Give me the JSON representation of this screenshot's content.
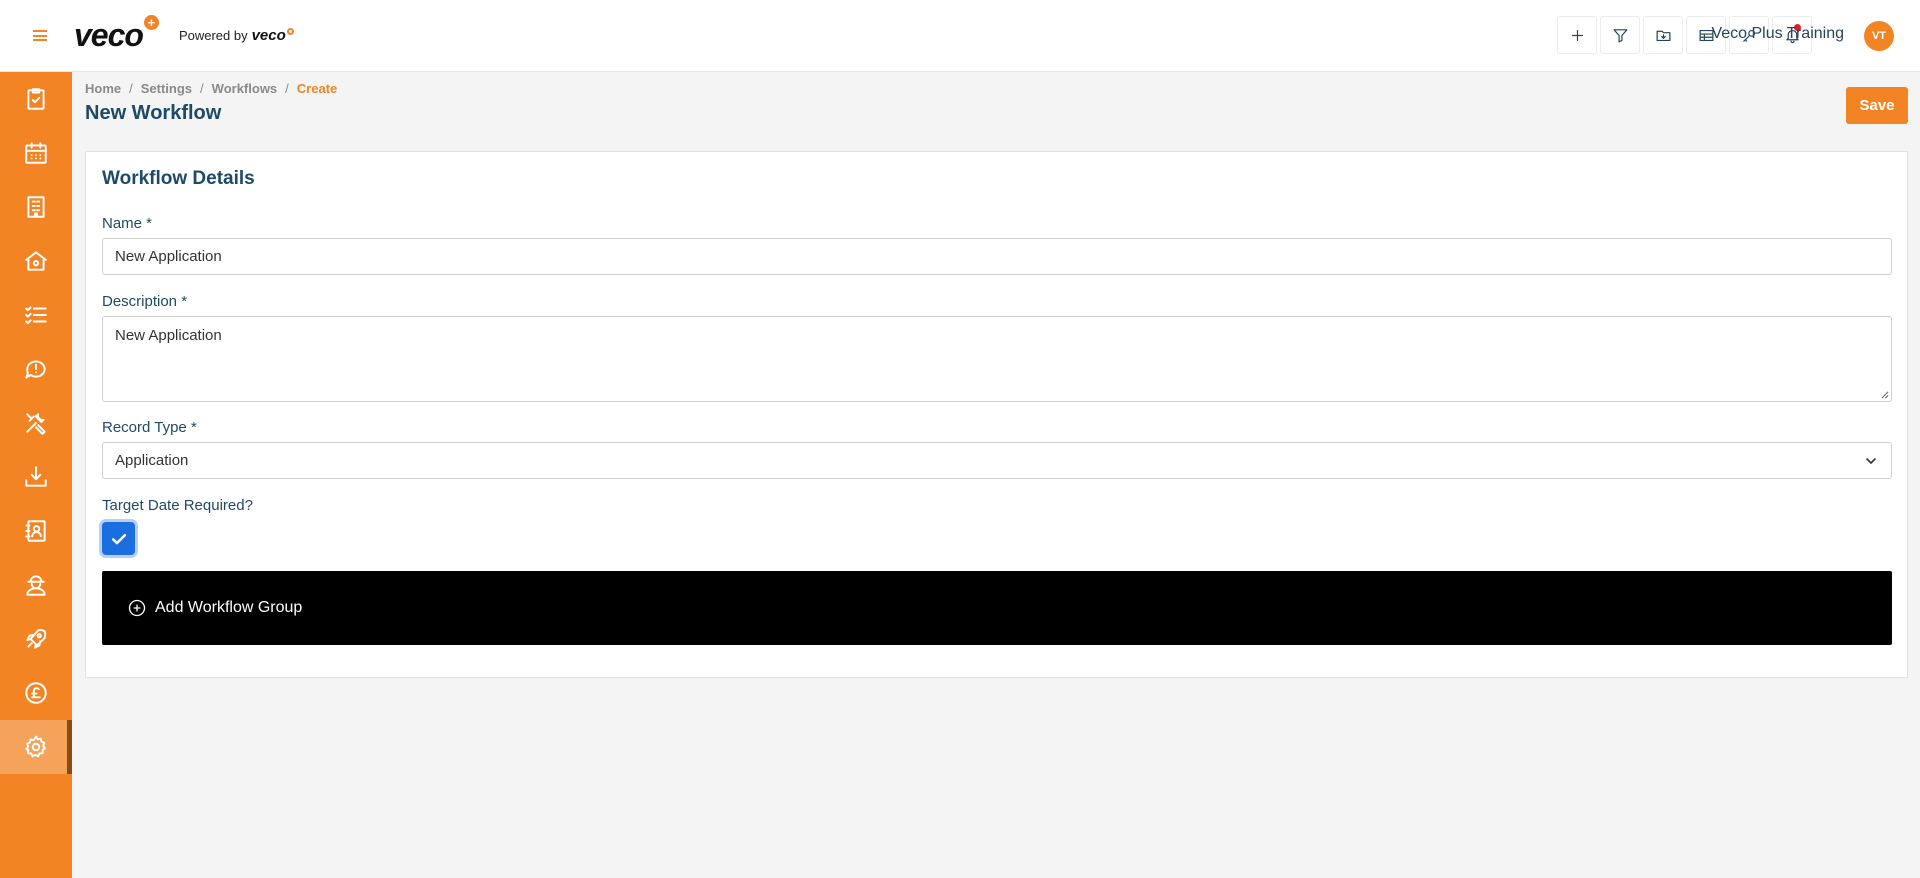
{
  "header": {
    "logo_text": "veco",
    "logo_plus": "+",
    "powered_by_label": "Powered by",
    "powered_by_brand": "veco",
    "user_name": "Veco Plus Training",
    "user_initials": "VT",
    "action_icons": [
      "plus-icon",
      "filter-icon",
      "folder-download-icon",
      "table-icon",
      "key-icon",
      "bell-icon"
    ]
  },
  "sidebar": {
    "items": [
      {
        "icon": "clipboard-check-icon"
      },
      {
        "icon": "calendar-icon"
      },
      {
        "icon": "building-icon"
      },
      {
        "icon": "home-icon"
      },
      {
        "icon": "checklist-icon"
      },
      {
        "icon": "alert-chat-icon"
      },
      {
        "icon": "tools-icon"
      },
      {
        "icon": "download-tray-icon"
      },
      {
        "icon": "contacts-book-icon"
      },
      {
        "icon": "worker-icon"
      },
      {
        "icon": "rocket-icon"
      },
      {
        "icon": "pound-coin-icon"
      },
      {
        "icon": "gear-icon",
        "active": true
      }
    ]
  },
  "breadcrumb": {
    "items": [
      "Home",
      "Settings",
      "Workflows"
    ],
    "current": "Create",
    "separator": "/"
  },
  "page": {
    "title": "New Workflow",
    "save_label": "Save"
  },
  "form": {
    "section_title": "Workflow Details",
    "name_label": "Name *",
    "name_value": "New Application",
    "description_label": "Description *",
    "description_value": "New Application",
    "record_type_label": "Record Type *",
    "record_type_value": "Application",
    "target_date_label": "Target Date Required?",
    "target_date_checked": true,
    "add_group_label": "Add Workflow Group"
  },
  "colors": {
    "brand_orange": "#f28424",
    "title_blue": "#1e4a66",
    "checkbox_blue": "#1a6ee0",
    "add_group_bg": "#000000"
  }
}
